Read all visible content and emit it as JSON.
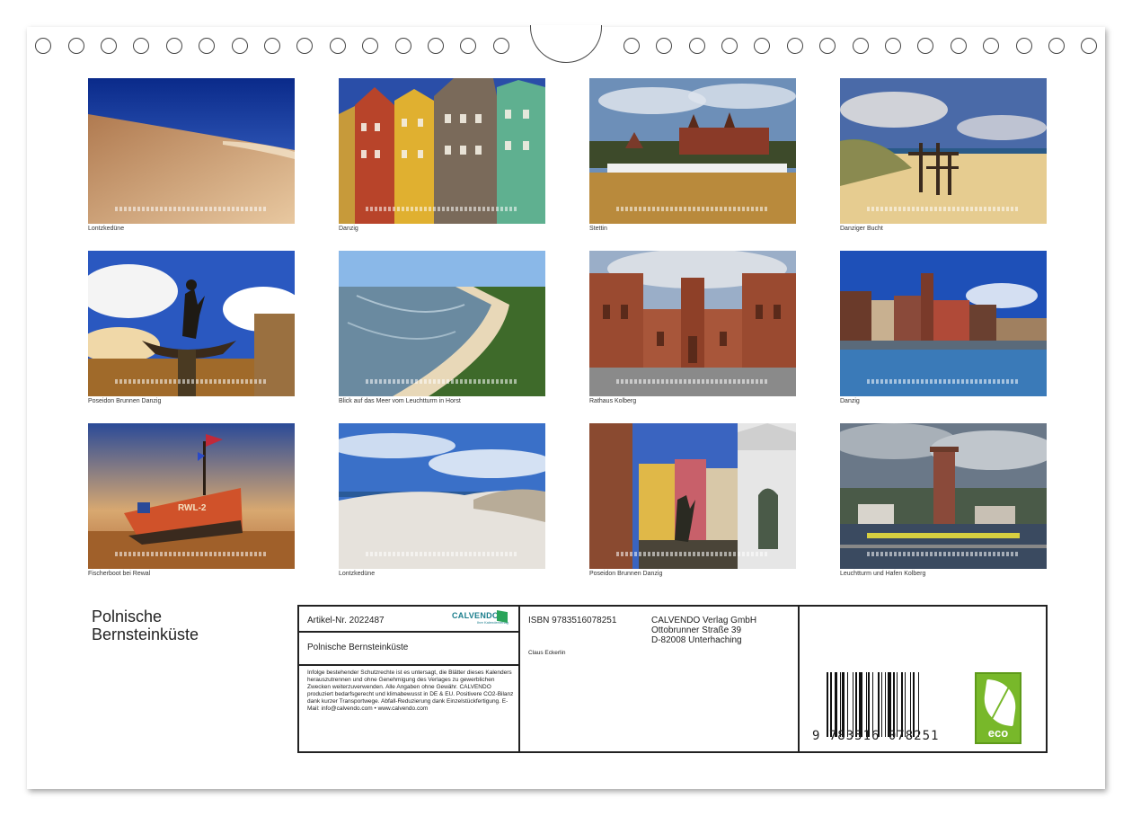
{
  "photos": [
    {
      "caption": "Lontzkedüne",
      "scene": "dune"
    },
    {
      "caption": "Danzig",
      "scene": "facades"
    },
    {
      "caption": "Stettin",
      "scene": "castle-river"
    },
    {
      "caption": "Danziger Bucht",
      "scene": "beach-cross"
    },
    {
      "caption": "Poseidon Brunnen Danzig",
      "scene": "fountain-sky"
    },
    {
      "caption": "Blick auf das Meer vom Leuchtturm in Horst",
      "scene": "coast-aerial"
    },
    {
      "caption": "Rathaus Kolberg",
      "scene": "town-hall"
    },
    {
      "caption": "Danzig",
      "scene": "waterfront"
    },
    {
      "caption": "Fischerboot bei Rewal",
      "scene": "fishing-boat"
    },
    {
      "caption": "Lontzkedüne",
      "scene": "dunes-clouds"
    },
    {
      "caption": "Poseidon Brunnen Danzig",
      "scene": "fountain-street"
    },
    {
      "caption": "Leuchtturm und Hafen Kolberg",
      "scene": "lighthouse-harbor"
    }
  ],
  "boat_label": "RWL-2",
  "title_line1": "Polnische",
  "title_line2": "Bernsteinküste",
  "info": {
    "article": "Artikel-Nr. 2022487",
    "logo": "CALVENDO",
    "logo_sub": "Ihre Kalenderverlag",
    "product_title": "Polnische Bernsteinküste",
    "legal": "Infolge bestehender Schutzrechte ist es untersagt, die Blätter dieses Kalenders herauszutrennen und ohne Genehmigung des Verlages zu gewerblichen Zwecken weiterzuverwenden. Alle Angaben ohne Gewähr. CALVENDO produziert bedarfsgerecht und klimabewusst in DE & EU. Positivere CO2-Bilanz dank kurzer Transportwege. Abfall-Reduzierung dank Einzelstückfertigung. E-Mail: info@calvendo.com • www.calvendo.com",
    "isbn": "ISBN 9783516078251",
    "author": "Claus Eckerlin",
    "publisher1": "CALVENDO Verlag GmbH",
    "publisher2": "Ottobrunner Straße 39",
    "publisher3": "D-82008 Unterhaching",
    "barcode_number": "9 783516 078251",
    "eco_label": "eco"
  }
}
